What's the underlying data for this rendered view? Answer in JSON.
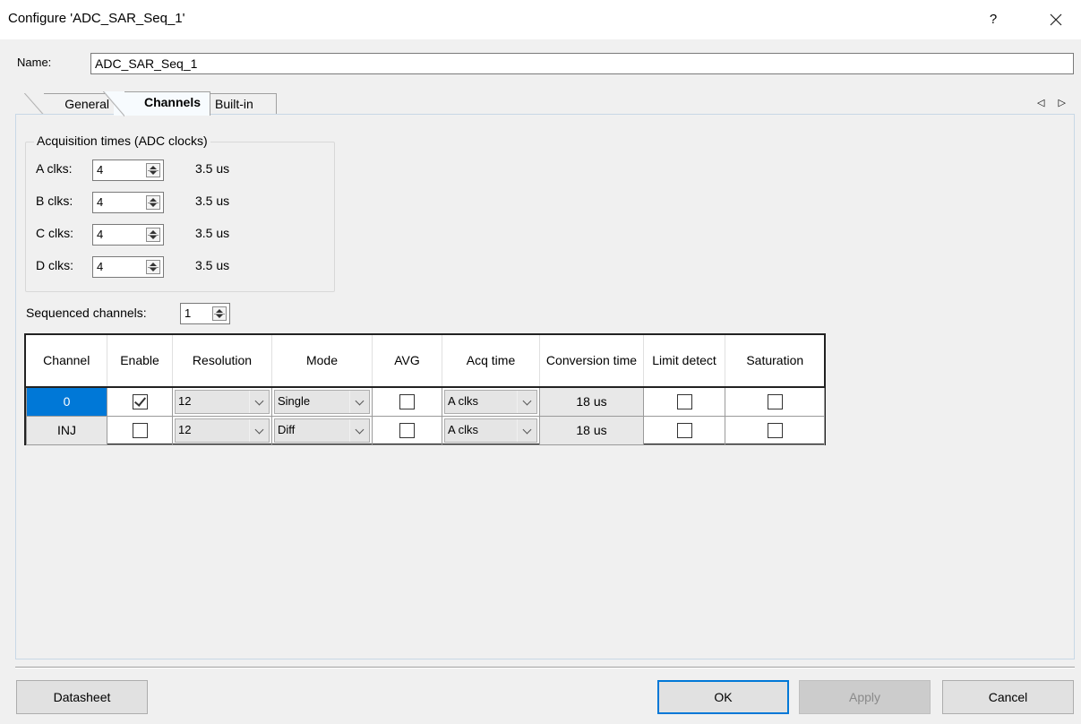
{
  "window": {
    "title": "Configure 'ADC_SAR_Seq_1'",
    "help": "?"
  },
  "name_row": {
    "label": "Name:",
    "value": "ADC_SAR_Seq_1"
  },
  "tabs": [
    {
      "label": "General"
    },
    {
      "label": "Channels"
    },
    {
      "label": "Built-in"
    }
  ],
  "tab_scroll": "◁ ▷",
  "acquisition": {
    "title": "Acquisition times (ADC clocks)",
    "rows": [
      {
        "label": "A clks:",
        "value": "4",
        "time": "3.5 us"
      },
      {
        "label": "B clks:",
        "value": "4",
        "time": "3.5 us"
      },
      {
        "label": "C clks:",
        "value": "4",
        "time": "3.5 us"
      },
      {
        "label": "D clks:",
        "value": "4",
        "time": "3.5 us"
      }
    ]
  },
  "sequenced": {
    "label": "Sequenced channels:",
    "value": "1"
  },
  "table": {
    "headers": [
      "Channel",
      "Enable",
      "Resolution",
      "Mode",
      "AVG",
      "Acq time",
      "Conversion time",
      "Limit detect",
      "Saturation"
    ],
    "rows": [
      {
        "channel": "0",
        "enable": true,
        "resolution": "12",
        "mode": "Single",
        "avg": false,
        "acq_time": "A clks",
        "conversion_time": "18 us",
        "limit_detect": false,
        "saturation": false,
        "selected": true
      },
      {
        "channel": "INJ",
        "enable": false,
        "resolution": "12",
        "mode": "Diff",
        "avg": false,
        "acq_time": "A clks",
        "conversion_time": "18 us",
        "limit_detect": false,
        "saturation": false,
        "selected": false
      }
    ]
  },
  "footer": {
    "datasheet": "Datasheet",
    "ok": "OK",
    "apply": "Apply",
    "cancel": "Cancel"
  },
  "colors": {
    "accent": "#0078d7",
    "background": "#f0f0f0"
  }
}
